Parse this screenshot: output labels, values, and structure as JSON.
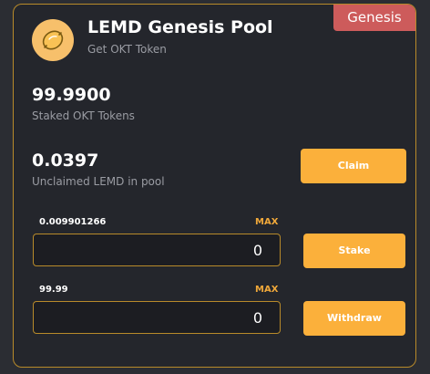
{
  "pool": {
    "badge": "Genesis",
    "title": "LEMD Genesis Pool",
    "subtitle": "Get OKT Token",
    "logo_icon": "lemon-icon"
  },
  "staked": {
    "value": "99.9900",
    "label": "Staked OKT Tokens"
  },
  "unclaimed": {
    "value": "0.0397",
    "label": "Unclaimed LEMD in pool"
  },
  "actions": {
    "claim_label": "Claim",
    "stake_label": "Stake",
    "withdraw_label": "Withdraw"
  },
  "stake_form": {
    "balance": "0.009901266",
    "max_label": "MAX",
    "value": "0"
  },
  "withdraw_form": {
    "balance": "99.99",
    "max_label": "MAX",
    "value": "0"
  },
  "colors": {
    "accent": "#fbb03b",
    "badge": "#cd5b5b",
    "border": "#b88a2a",
    "card_bg": "#24262c"
  }
}
